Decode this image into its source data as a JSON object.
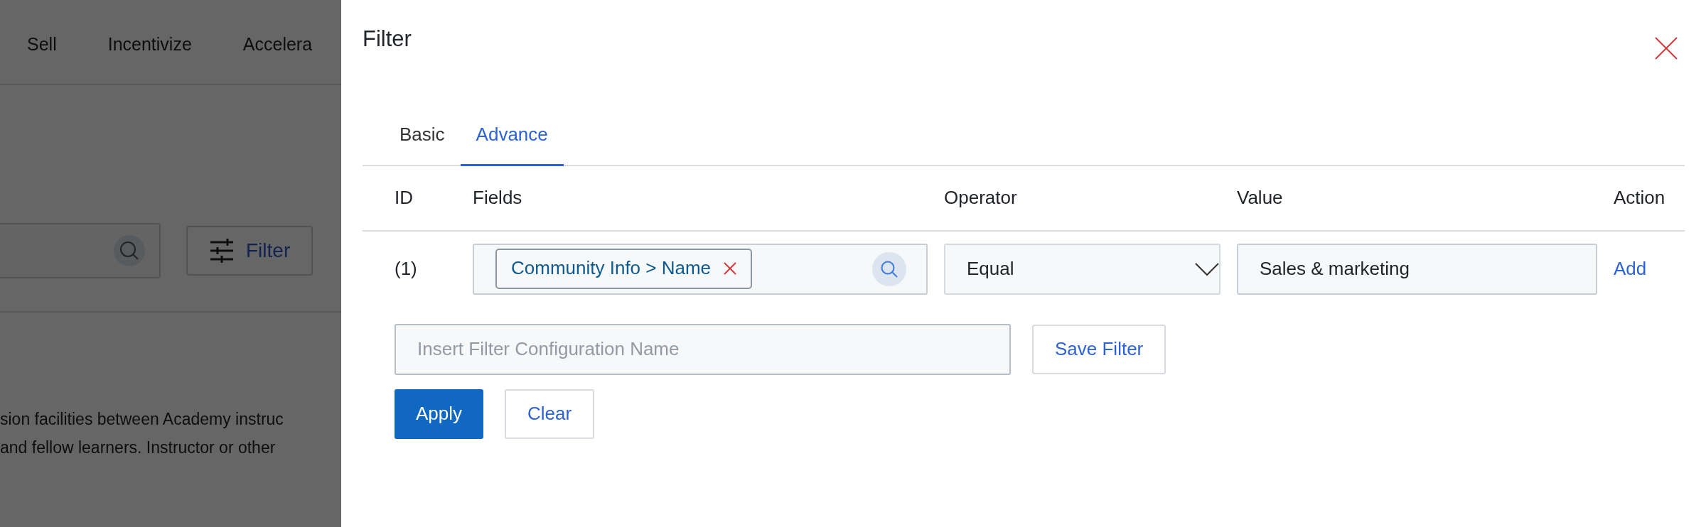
{
  "background": {
    "nav": [
      "Sell",
      "Incentivize",
      "Accelera"
    ],
    "filter_button": "Filter",
    "text_lines": [
      "sion facilities between Academy instruc",
      "and fellow learners. Instructor or other"
    ]
  },
  "panel": {
    "title": "Filter",
    "tabs": [
      {
        "label": "Basic",
        "selected": false
      },
      {
        "label": "Advance",
        "selected": true
      }
    ],
    "columns": [
      "ID",
      "Fields",
      "Operator",
      "Value",
      "Action"
    ],
    "rows": [
      {
        "id": "(1)",
        "field_tags": [
          "Community Info > Name"
        ],
        "operator": "Equal",
        "value": "Sales & marketing",
        "action": "Add"
      }
    ],
    "config_name": {
      "placeholder": "Insert Filter Configuration Name"
    },
    "save_button": "Save Filter",
    "apply_button": "Apply",
    "clear_button": "Clear"
  }
}
